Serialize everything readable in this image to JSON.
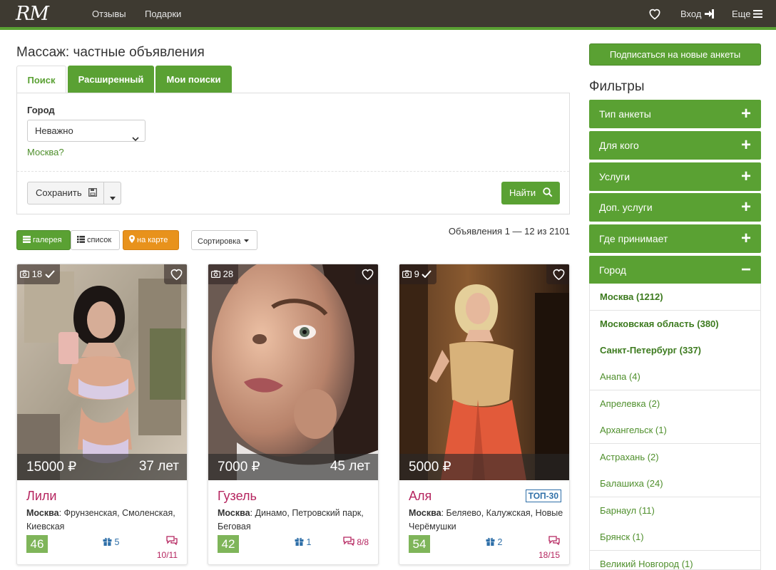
{
  "nav": {
    "logo": "RM",
    "links": [
      "Отзывы",
      "Подарки"
    ],
    "login": "Вход",
    "more": "Еще"
  },
  "page": {
    "title": "Массаж: частные объявления"
  },
  "tabs": [
    "Поиск",
    "Расширенный",
    "Мои поиски"
  ],
  "search": {
    "city_label": "Город",
    "city_value": "Неважно",
    "city_hint": "Москва?",
    "save_label": "Сохранить",
    "find_label": "Найти"
  },
  "view": {
    "gallery": "галерея",
    "list": "список",
    "map": "на карте",
    "sort": "Сортировка",
    "count": "Объявления 1 — 12 из 2101"
  },
  "cards": [
    {
      "photos": "18",
      "verified": true,
      "price": "15000 ₽",
      "age_text": "37 лет",
      "name": "Лили",
      "city": "Москва",
      "metro": ": Фрунзенская, Смоленская, Киевская",
      "age_badge": "46",
      "gifts": "5",
      "reviews": "",
      "reviews2": "10/11",
      "top": ""
    },
    {
      "photos": "28",
      "verified": false,
      "price": "7000 ₽",
      "age_text": "45 лет",
      "name": "Гузель",
      "city": "Москва",
      "metro": ": Динамо, Петровский парк, Беговая",
      "age_badge": "42",
      "gifts": "1",
      "reviews": "8/8",
      "reviews2": "",
      "top": ""
    },
    {
      "photos": "9",
      "verified": true,
      "price": "5000 ₽",
      "age_text": "",
      "name": "Аля",
      "city": "Москва",
      "metro": ": Беляево, Калужская, Новые Черёмушки",
      "age_badge": "54",
      "gifts": "2",
      "reviews": "",
      "reviews2": "18/15",
      "top": "ТОП-30"
    }
  ],
  "sidebar": {
    "subscribe": "Подписаться на новые анкеты",
    "filters_title": "Фильтры",
    "accordions": [
      {
        "label": "Тип анкеты",
        "state": "+"
      },
      {
        "label": "Для кого",
        "state": "+"
      },
      {
        "label": "Услуги",
        "state": "+"
      },
      {
        "label": "Доп. услуги",
        "state": "+"
      },
      {
        "label": "Где принимает",
        "state": "+"
      },
      {
        "label": "Город",
        "state": "−"
      }
    ],
    "cities": [
      "Москва (1212)",
      "Московская область (380)",
      "Санкт-Петербург (337)",
      "Анапа (4)",
      "Апрелевка (2)",
      "Архангельск (1)",
      "Астрахань (2)",
      "Балашиха (24)",
      "Барнаул (11)",
      "Брянск (1)",
      "Великий Новгород (1)"
    ]
  },
  "colors": {
    "brand_green": "#5aa133",
    "topbar": "#3e3a31",
    "name_pink": "#b5255f",
    "map_orange": "#e8921c",
    "link_blue": "#2e6fa8"
  }
}
